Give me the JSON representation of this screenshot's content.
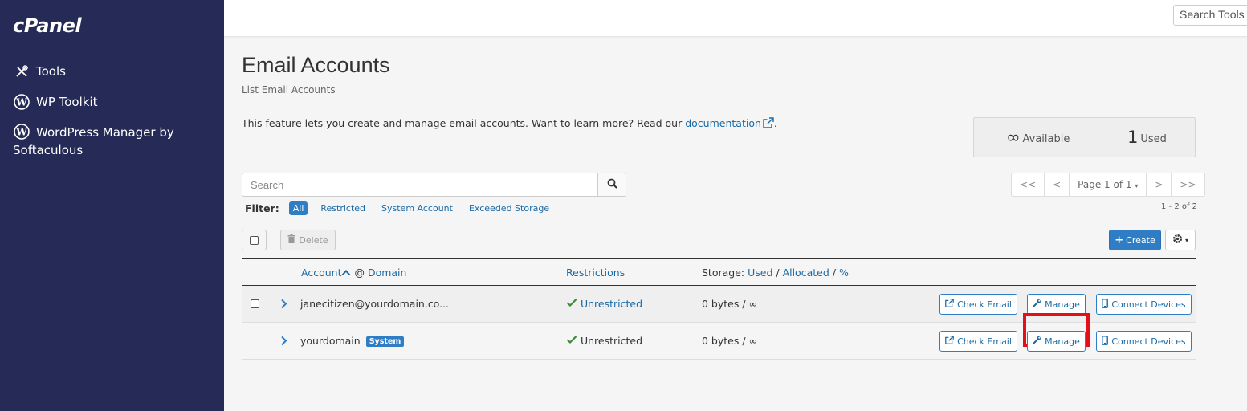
{
  "sidebar": {
    "logo": "cPanel",
    "items": [
      {
        "label": "Tools",
        "icon": "tools-icon"
      },
      {
        "label": "WP Toolkit",
        "icon": "wordpress-icon"
      },
      {
        "label": "WordPress Manager by Softaculous",
        "icon": "wordpress-icon"
      }
    ]
  },
  "topbar": {
    "search_value": "Search Tools"
  },
  "page": {
    "title": "Email Accounts",
    "subtitle": "List Email Accounts",
    "intro_text": "This feature lets you create and manage email accounts. Want to learn more? Read our ",
    "intro_link": "documentation",
    "intro_end": "."
  },
  "stats": {
    "available_value": "∞",
    "available_label": "Available",
    "used_value": "1",
    "used_label": "Used"
  },
  "search": {
    "placeholder": "Search"
  },
  "filter": {
    "label": "Filter:",
    "options": [
      "All",
      "Restricted",
      "System Account",
      "Exceeded Storage"
    ],
    "active": "All"
  },
  "pager": {
    "first": "<<",
    "prev": "<",
    "page_label": "Page 1 of 1",
    "next": ">",
    "last": ">>",
    "count": "1 - 2 of 2"
  },
  "toolbar": {
    "delete_label": "Delete",
    "create_label": "Create"
  },
  "table": {
    "headers": {
      "account": "Account",
      "at": " @ ",
      "domain": "Domain",
      "restrictions": "Restrictions",
      "storage_prefix": "Storage: ",
      "used": "Used",
      "sep": " / ",
      "allocated": "Allocated",
      "percent": "%"
    },
    "rows": [
      {
        "account": "janecitizen@yourdomain.co...",
        "badge": "",
        "restriction": "Unrestricted",
        "storage": "0 bytes / ∞",
        "check_email": "Check Email",
        "manage": "Manage",
        "connect": "Connect Devices"
      },
      {
        "account": "yourdomain",
        "badge": "System",
        "restriction": "Unrestricted",
        "storage": "0 bytes / ∞",
        "check_email": "Check Email",
        "manage": "Manage",
        "connect": "Connect Devices"
      }
    ]
  },
  "colors": {
    "sidebar_bg": "#262a56",
    "accent": "#2f7ec5",
    "link": "#1b6aa5",
    "success": "#3c8c3c",
    "highlight": "#e3101a"
  }
}
